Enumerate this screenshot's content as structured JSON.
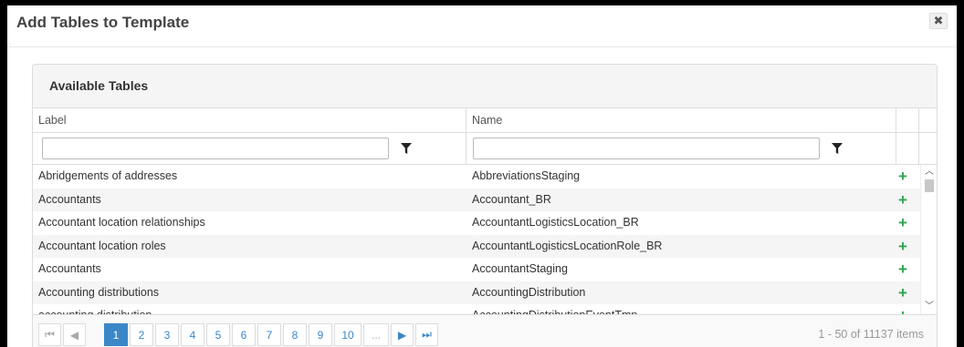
{
  "dialog": {
    "title": "Add Tables to Template",
    "close_icon": "close-icon"
  },
  "panel": {
    "title": "Available Tables"
  },
  "grid": {
    "columns": [
      "Label",
      "Name"
    ],
    "filter_icon": "filter-icon",
    "add_icon": "plus-icon",
    "rows": [
      {
        "label": "Abridgements of addresses",
        "name": "AbbreviationsStaging"
      },
      {
        "label": "Accountants",
        "name": "Accountant_BR"
      },
      {
        "label": "Accountant location relationships",
        "name": "AccountantLogisticsLocation_BR"
      },
      {
        "label": "Accountant location roles",
        "name": "AccountantLogisticsLocationRole_BR"
      },
      {
        "label": "Accountants",
        "name": "AccountantStaging"
      },
      {
        "label": "Accounting distributions",
        "name": "AccountingDistribution"
      },
      {
        "label": "accounting distribution",
        "name": "AccountingDistributionEventTmp"
      }
    ]
  },
  "pager": {
    "first": "⏮",
    "prev": "◀",
    "pages": [
      "1",
      "2",
      "3",
      "4",
      "5",
      "6",
      "7",
      "8",
      "9",
      "10",
      "..."
    ],
    "current_page": "1",
    "next": "▶",
    "last": "⏭",
    "info": "1 - 50 of 11137 items"
  }
}
